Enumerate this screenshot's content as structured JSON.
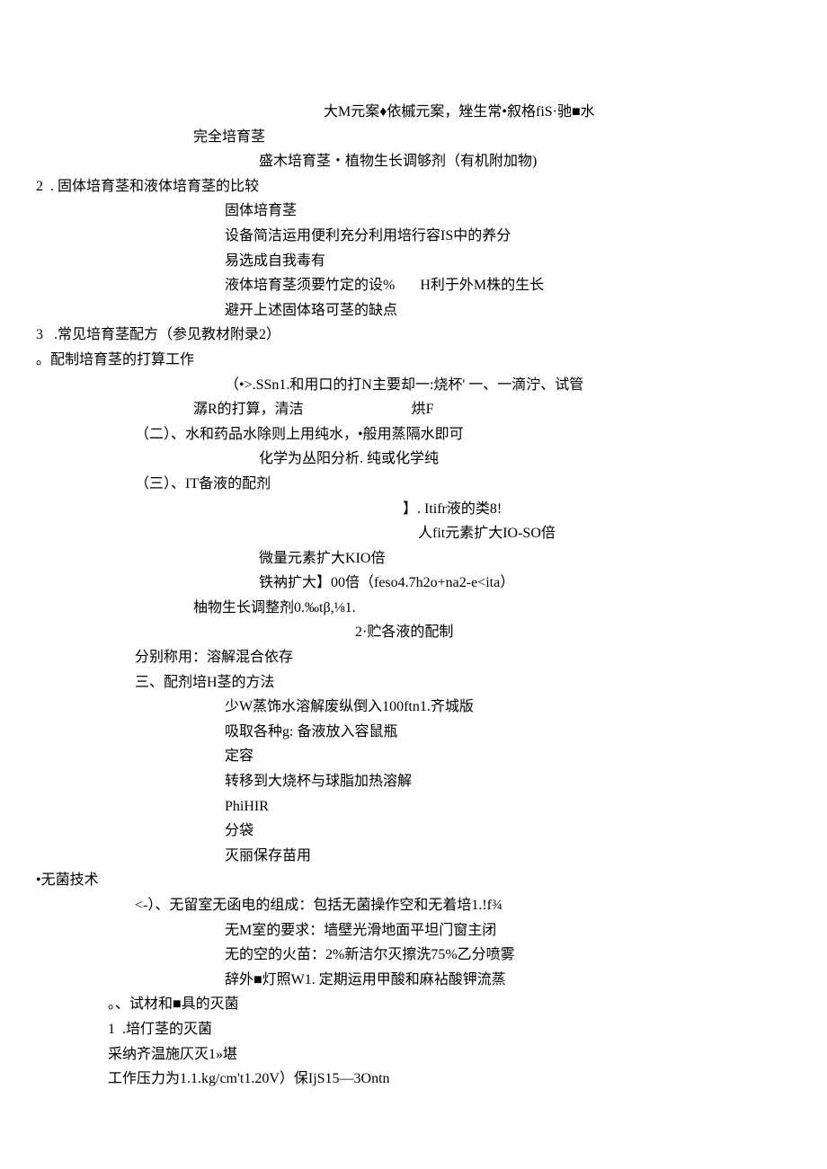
{
  "lines": {
    "l01": "大M元案♦依槭元案，矬生常•叙格fiS·驰■水",
    "l02": "完全培育茎",
    "l03": "盛木培育茎・植物生长调够剂（有机附加物)",
    "l04": "2  . 固体培育茎和液体培育茎的比较",
    "l05": "固体培育茎",
    "l06": "设备简洁运用便利充分利用培行容IS中的养分",
    "l07": "易选成自我毒有",
    "l08": "液体培育茎须要竹定的设%       H利于外M株的生长",
    "l09": "避开上述固体珞可茎的缺点",
    "l10": "3   .常见培育茎配方（参见教材附录2）",
    "l11": "。配制培育茎的打算工作",
    "l12": "（•>.SSn1.和用口的打N主要却一:烧杯' 一、一滴泞、试管",
    "l13": "潺R的打算，清洁                              烘F",
    "l14": "（二）、水和药品水除则上用纯水，•般用蒸隔水即可",
    "l15": "化学为丛阳分析. 纯或化学纯",
    "l16": "（三）、IT备液的配剂",
    "l17": "】. Itifr液的类8!",
    "l18": "人fit元素扩大IO-SO倍",
    "l19": "微量元素扩大KIO倍",
    "l20": "铁衲扩大】00倍（feso4.7h2o+na2-e<ita）",
    "l21": "柚物生长调整剂0.‰tβ,⅛1.",
    "l22": "2·贮各液的配制",
    "l23": "分别称用：溶解混合依存",
    "l24": "三、配剂培H茎的方法",
    "l25": "少W蒸饰水溶解废纵倒入100ftn1.齐城版",
    "l26": "吸取各种g: 备液放入容鼠瓶",
    "l27": "定容",
    "l28": "转移到大烧杯与球脂加热溶解",
    "l29": "PhiHIR",
    "l30": "分袋",
    "l31": "灭丽保存苗用",
    "l32": "•无菌技术",
    "l33": "<-）、无留室无函电的组成：包括无菌操作空和无着培1.!f¾",
    "l34": "无M室的要求：墙壁光滑地面平坦门窗主闭",
    "l35": "无的空的火苗：2%新洁尔灭擦洗75%乙分喷雾",
    "l36": "辞外■灯照W1. 定期运用甲酸和麻袩酸钾流蒸",
    "l37": "。、试材和■具的灭菌",
    "l38": "1  .培仃茎的灭菌",
    "l39": "采纳齐温施仄灭1»堪",
    "l40": "工作压力为1.1.kg/cm't1.20V）保IjS15—3Ontn"
  }
}
